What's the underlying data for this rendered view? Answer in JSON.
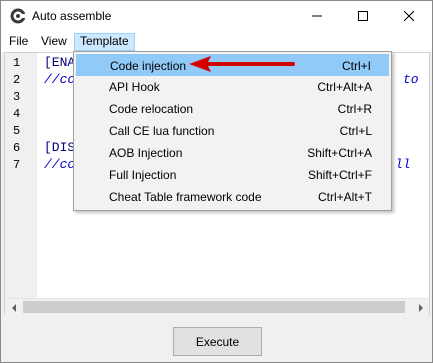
{
  "window": {
    "title": "Auto assemble",
    "controls": [
      "minimize",
      "maximize",
      "close"
    ]
  },
  "menubar": {
    "items": [
      {
        "label": "File"
      },
      {
        "label": "View"
      },
      {
        "label": "Template",
        "open": true
      }
    ]
  },
  "editor": {
    "line_numbers": [
      "1",
      "2",
      "3",
      "4",
      "5",
      "6",
      "7"
    ],
    "lines": [
      {
        "text": "[ENA",
        "style": "keyword"
      },
      {
        "text": "//co",
        "style": "comment"
      },
      {
        "text": "",
        "style": "keyword"
      },
      {
        "text": "",
        "style": "keyword"
      },
      {
        "text": "",
        "style": "keyword"
      },
      {
        "text": "[DIS",
        "style": "keyword"
      },
      {
        "text": "//co",
        "style": "comment"
      }
    ],
    "right_fragments": {
      "line2": "to",
      "line7": "ll"
    }
  },
  "template_menu": {
    "items": [
      {
        "label": "Code injection",
        "shortcut": "Ctrl+I",
        "selected": true
      },
      {
        "label": "API Hook",
        "shortcut": "Ctrl+Alt+A"
      },
      {
        "label": "Code relocation",
        "shortcut": "Ctrl+R"
      },
      {
        "label": "Call CE lua function",
        "shortcut": "Ctrl+L"
      },
      {
        "label": "AOB Injection",
        "shortcut": "Shift+Ctrl+A"
      },
      {
        "label": "Full Injection",
        "shortcut": "Shift+Ctrl+F"
      },
      {
        "label": "Cheat Table framework code",
        "shortcut": "Ctrl+Alt+T"
      }
    ]
  },
  "buttons": {
    "execute": "Execute"
  },
  "colors": {
    "menu_highlight": "#cce8ff",
    "item_selected": "#91c9f7",
    "annotation_arrow": "#d40000",
    "code_keyword": "#000080",
    "code_comment": "#0000cc"
  }
}
